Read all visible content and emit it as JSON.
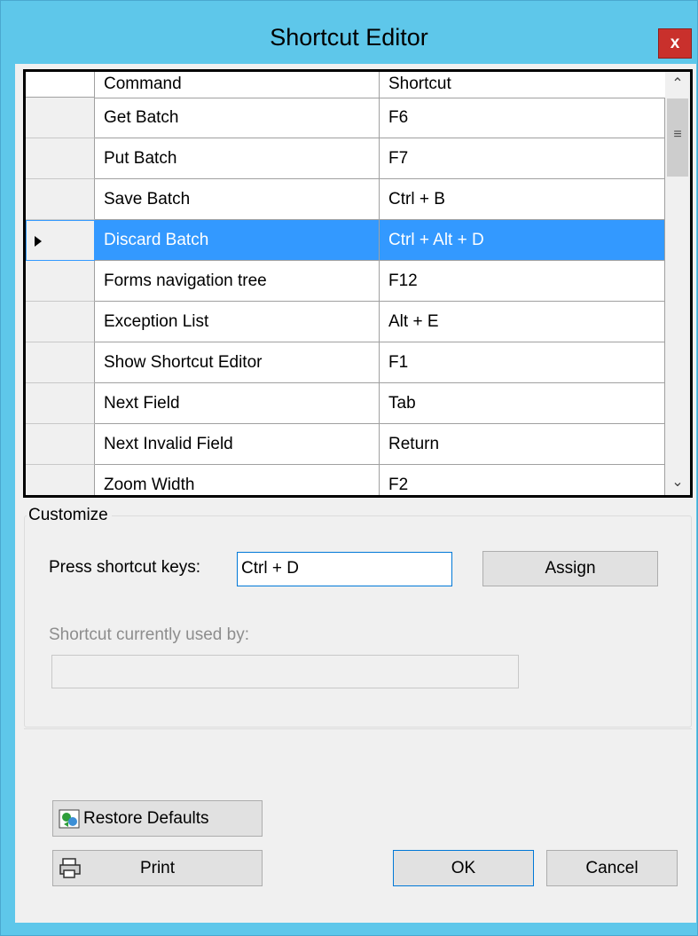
{
  "window": {
    "title": "Shortcut Editor",
    "close_label": "x"
  },
  "grid": {
    "columns": [
      "Command",
      "Shortcut"
    ],
    "selected_index": 3,
    "rows": [
      {
        "command": "Get Batch",
        "shortcut": "F6"
      },
      {
        "command": "Put Batch",
        "shortcut": "F7"
      },
      {
        "command": "Save Batch",
        "shortcut": "Ctrl + B"
      },
      {
        "command": "Discard Batch",
        "shortcut": "Ctrl + Alt + D"
      },
      {
        "command": "Forms navigation tree",
        "shortcut": "F12"
      },
      {
        "command": "Exception List",
        "shortcut": "Alt + E"
      },
      {
        "command": "Show Shortcut Editor",
        "shortcut": "F1"
      },
      {
        "command": "Next Field",
        "shortcut": "Tab"
      },
      {
        "command": "Next Invalid Field",
        "shortcut": "Return"
      },
      {
        "command": "Zoom Width",
        "shortcut": "F2"
      }
    ]
  },
  "customize": {
    "legend": "Customize",
    "press_label": "Press shortcut keys:",
    "shortcut_value": "Ctrl + D",
    "assign_label": "Assign",
    "used_by_label": "Shortcut currently used by:",
    "used_by_value": ""
  },
  "buttons": {
    "restore_label": "Restore Defaults",
    "print_label": "Print",
    "ok_label": "OK",
    "cancel_label": "Cancel"
  },
  "colors": {
    "title_bar": "#5ec7ea",
    "selection": "#3399ff",
    "close": "#c9302c"
  }
}
